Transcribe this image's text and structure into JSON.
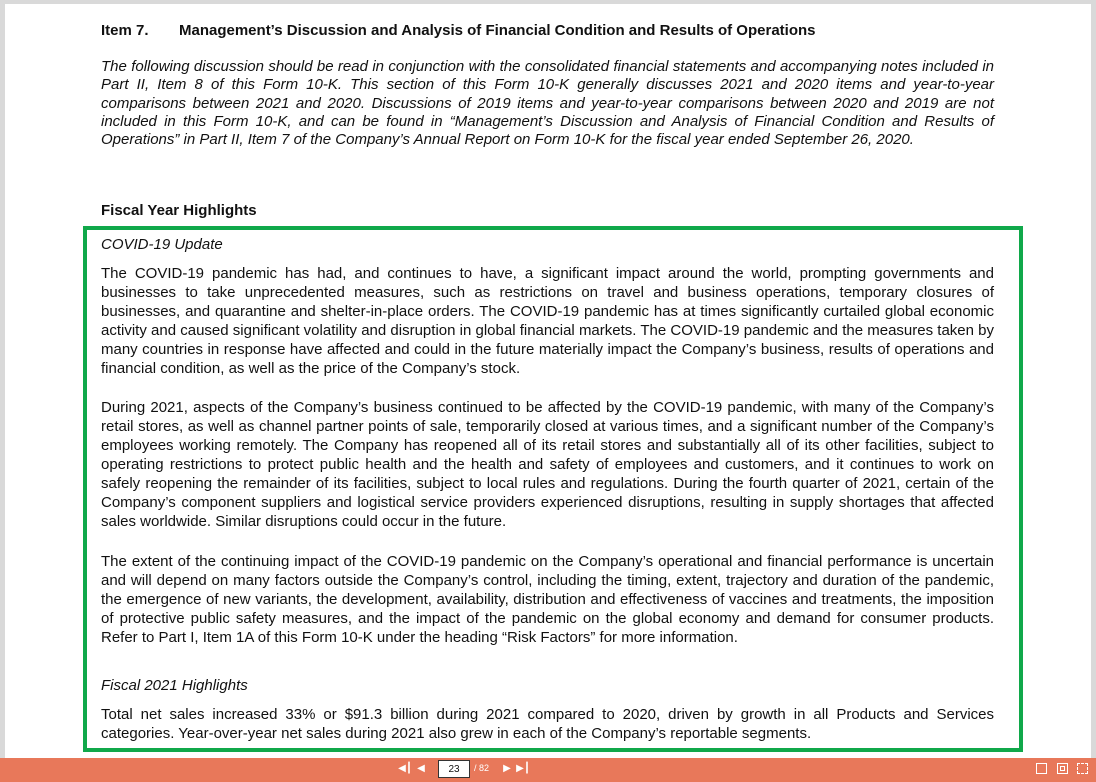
{
  "document": {
    "item_number": "Item 7.",
    "item_title": "Management’s Discussion and Analysis of Financial Condition and Results of Operations",
    "intro": "The following discussion should be read in conjunction with the consolidated financial statements and accompanying notes included in Part II, Item 8 of this Form 10-K. This section of this Form 10-K generally discusses 2021 and 2020 items and year-to-year comparisons between 2021 and 2020. Discussions of 2019 items and year-to-year comparisons between 2020 and 2019 are not included in this Form 10-K, and can be found in “Management’s Discussion and Analysis of Financial Condition and Results of Operations” in Part II, Item 7 of the Company’s Annual Report on Form 10-K for the fiscal year ended September 26, 2020.",
    "fiscal_year_highlights_heading": "Fiscal Year Highlights",
    "covid_heading": "COVID-19 Update",
    "covid_paragraphs": [
      "The COVID-19 pandemic has had, and continues to have, a significant impact around the world, prompting governments and businesses to take unprecedented measures, such as restrictions on travel and business operations, temporary closures of businesses, and quarantine and shelter-in-place orders. The COVID-19 pandemic has at times significantly curtailed global economic activity and caused significant volatility and disruption in global financial markets. The COVID-19 pandemic and the measures taken by many countries in response have affected and could in the future materially impact the Company’s business, results of operations and financial condition, as well as the price of the Company’s stock.",
      "During 2021, aspects of the Company’s business continued to be affected by the COVID-19 pandemic, with many of the Company’s retail stores, as well as channel partner points of sale, temporarily closed at various times, and a significant number of the Company’s employees working remotely. The Company has reopened all of its retail stores and substantially all of its other facilities, subject to operating restrictions to protect public health and the health and safety of employees and customers, and it continues to work on safely reopening the remainder of its facilities, subject to local rules and regulations. During the fourth quarter of 2021, certain of the Company’s component suppliers and logistical service providers experienced disruptions, resulting in supply shortages that affected sales worldwide. Similar disruptions could occur in the future.",
      "The extent of the continuing impact of the COVID-19 pandemic on the Company’s operational and financial performance is uncertain and will depend on many factors outside the Company’s control, including the timing, extent, trajectory and duration of the pandemic, the emergence of new variants, the development, availability, distribution and effectiveness of vaccines and treatments, the imposition of protective public safety measures, and the impact of the pandemic on the global economy and demand for consumer products. Refer to Part I, Item 1A of this Form 10-K under the heading “Risk Factors” for more information."
    ],
    "fiscal_2021_heading": "Fiscal 2021 Highlights",
    "fiscal_2021_paragraph": "Total net sales increased 33% or $91.3 billion during 2021 compared to 2020, driven by growth in all Products and Services categories. Year-over-year net sales during 2021 also grew in each of the Company’s reportable segments."
  },
  "toolbar": {
    "current_page": "23",
    "total_pages": "/ 82",
    "first_icon": "first-page-icon",
    "prev_icon": "previous-page-icon",
    "next_icon": "next-page-icon",
    "last_icon": "last-page-icon"
  },
  "colors": {
    "highlight_border": "#10a84a",
    "toolbar_bg": "#e8785a",
    "viewer_bg": "#d9d9d9"
  }
}
